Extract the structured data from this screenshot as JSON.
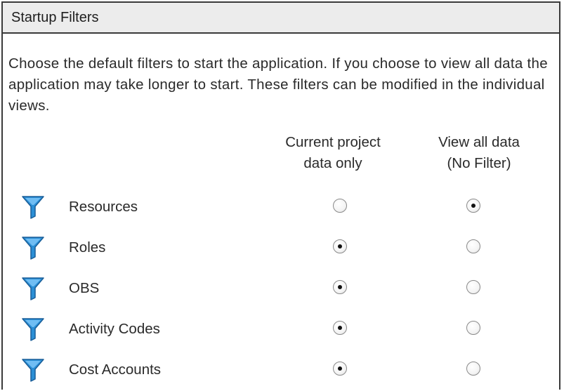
{
  "panel": {
    "title": "Startup Filters",
    "description": "Choose the default filters to start the application.  If you choose to view all data the application may take longer to start.  These filters can be modified in the individual views."
  },
  "columns": [
    {
      "line1": "Current project",
      "line2": "data only"
    },
    {
      "line1": "View all data",
      "line2": "(No Filter)"
    }
  ],
  "filters": [
    {
      "label": "Resources",
      "selected": "all"
    },
    {
      "label": "Roles",
      "selected": "current"
    },
    {
      "label": "OBS",
      "selected": "current"
    },
    {
      "label": "Activity Codes",
      "selected": "current"
    },
    {
      "label": "Cost Accounts",
      "selected": "current"
    }
  ],
  "colors": {
    "icon_blue": "#2b8fd6",
    "border": "#3a3a3a"
  },
  "icon": "filter-funnel-icon"
}
